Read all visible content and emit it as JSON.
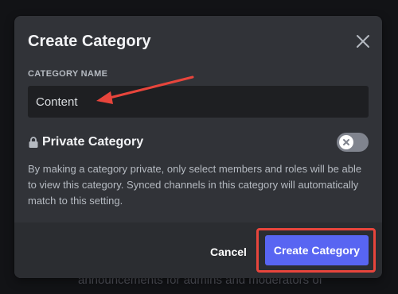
{
  "background": {
    "text": "announcements for admins and moderators of"
  },
  "dialog": {
    "title": "Create Category",
    "close_icon": "close-icon",
    "name_field": {
      "label": "CATEGORY NAME",
      "value": "Content"
    },
    "private": {
      "icon": "lock-icon",
      "label": "Private Category",
      "enabled": false,
      "description": "By making a category private, only select members and roles will be able to view this category. Synced channels in this category will automatically match to this setting."
    },
    "footer": {
      "cancel_label": "Cancel",
      "create_label": "Create Category"
    }
  },
  "annotations": {
    "arrow_color": "#e8453c",
    "highlight_color": "#e8453c"
  },
  "colors": {
    "modal_bg": "#313338",
    "footer_bg": "#2b2d31",
    "input_bg": "#1e1f22",
    "accent": "#5865f2",
    "toggle_off": "#80848e"
  }
}
